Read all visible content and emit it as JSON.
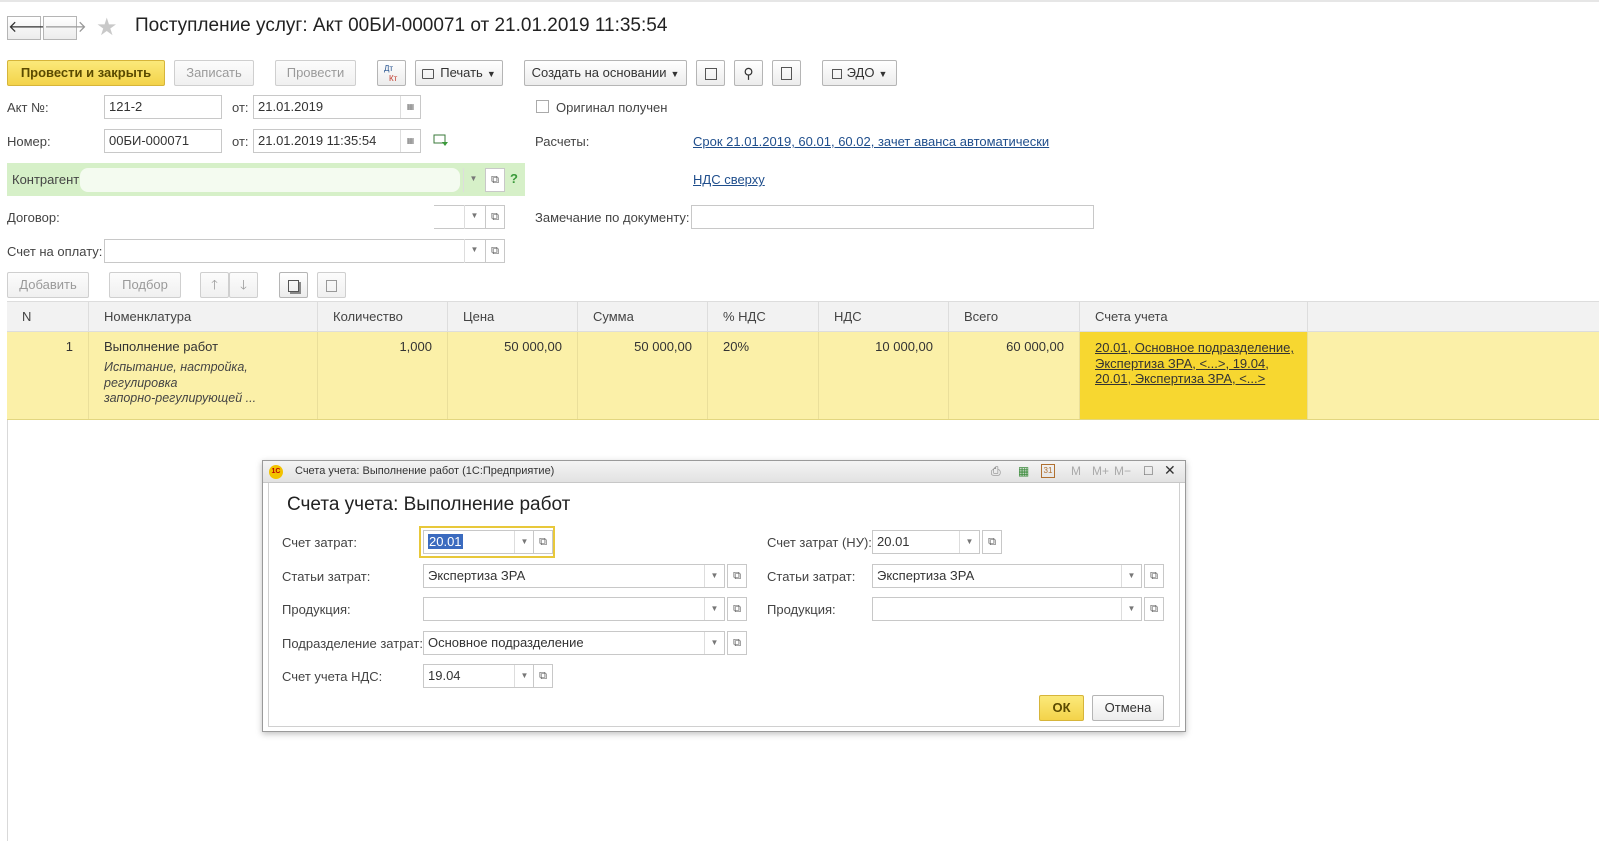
{
  "header": {
    "title": "Поступление услуг: Акт 00БИ-000071 от 21.01.2019 11:35:54",
    "back_glyph": "🡐",
    "forward_glyph": "🡒",
    "favorite_glyph": "★"
  },
  "toolbar": {
    "post_close": "Провести и закрыть",
    "save": "Записать",
    "post": "Провести",
    "dt_kt": "Дт\nКт",
    "print": "Печать",
    "create_based": "Создать на основании",
    "edo": "ЭДО"
  },
  "form": {
    "act_no_label": "Акт №:",
    "act_no_value": "121-2",
    "from_label": "от:",
    "act_date": "21.01.2019",
    "number_label": "Номер:",
    "number_value": "00БИ-000071",
    "number_date": "21.01.2019 11:35:54",
    "original_label": "Оригинал получен",
    "calculations_label": "Расчеты:",
    "calculations_link": "Срок 21.01.2019, 60.01, 60.02, зачет аванса автоматически",
    "vat_link": "НДС сверху",
    "counterparty_label": "Контрагент:",
    "contract_label": "Договор:",
    "invoice_label": "Счет на оплату:",
    "note_label": "Замечание по документу:",
    "note_value": "",
    "help_glyph": "?"
  },
  "table_toolbar": {
    "add": "Добавить",
    "select": "Подбор"
  },
  "table": {
    "columns": [
      "N",
      "Номенклатура",
      "Количество",
      "Цена",
      "Сумма",
      "% НДС",
      "НДС",
      "Всего",
      "Счета учета"
    ],
    "rows": [
      {
        "n": "1",
        "item": "Выполнение работ",
        "item_desc_1": "Испытание, настройка,",
        "item_desc_2": "регулировка",
        "item_desc_3": "запорно-регулирующей ...",
        "qty": "1,000",
        "price": "50 000,00",
        "sum": "50 000,00",
        "vat_rate": "20%",
        "vat": "10 000,00",
        "total": "60 000,00",
        "accounts_1": "20.01, Основное подразделение,",
        "accounts_2": "Экспертиза ЗРА, <...>, 19.04,",
        "accounts_3": "20.01, Экспертиза ЗРА, <...>"
      }
    ]
  },
  "dialog": {
    "window_title": "Счета учета: Выполнение работ  (1С:Предприятие)",
    "logo": "1С",
    "title": "Счета учета: Выполнение работ",
    "cost_account_label": "Счет затрат:",
    "cost_account_value": "20.01",
    "cost_items_label": "Статьи затрат:",
    "cost_items_value": "Экспертиза ЗРА",
    "product_label": "Продукция:",
    "product_value": "",
    "department_label": "Подразделение затрат:",
    "department_value": "Основное подразделение",
    "vat_account_label": "Счет учета НДС:",
    "vat_account_value": "19.04",
    "cost_account_nu_label": "Счет затрат (НУ):",
    "cost_account_nu_value": "20.01",
    "cost_items_nu_label": "Статьи затрат:",
    "cost_items_nu_value": "Экспертиза ЗРА",
    "product_nu_label": "Продукция:",
    "product_nu_value": "",
    "ok": "ОК",
    "cancel": "Отмена",
    "m_labels": [
      "M",
      "M+",
      "M−"
    ],
    "calendar_day": "31"
  },
  "colors": {
    "accent_yellow": "#f3d34a",
    "row_highlight": "#fbf0a8",
    "counterparty_bg": "#d6f0c8",
    "link": "#1f4e8c"
  }
}
